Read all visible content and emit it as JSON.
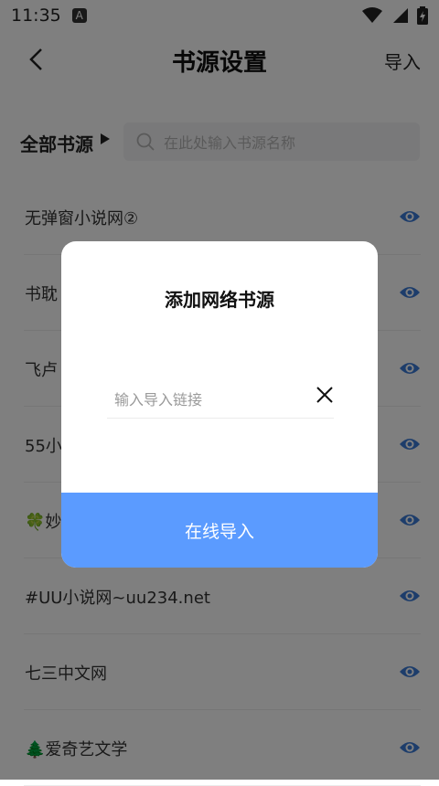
{
  "status_bar": {
    "time": "11:35",
    "notif_letter": "A"
  },
  "header": {
    "title": "书源设置",
    "import_label": "导入"
  },
  "filter": {
    "label": "全部书源",
    "search_placeholder": "在此处输入书源名称"
  },
  "sources": [
    {
      "name": "无弹窗小说网②"
    },
    {
      "name": "书耽"
    },
    {
      "name": "飞卢"
    },
    {
      "name": "55小"
    },
    {
      "name": "🍀妙"
    },
    {
      "name": "#UU小说网~uu234.net"
    },
    {
      "name": "七三中文网"
    },
    {
      "name": "🌲爱奇艺文学"
    }
  ],
  "dialog": {
    "title": "添加网络书源",
    "input_placeholder": "输入导入链接",
    "input_value": "",
    "confirm_label": "在线导入"
  },
  "colors": {
    "accent": "#5b9bff",
    "eye_icon": "#3b7bd6",
    "overlay": "rgba(0,0,0,0.5)"
  }
}
